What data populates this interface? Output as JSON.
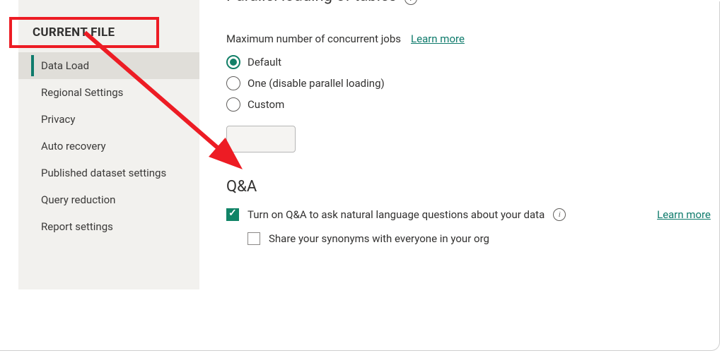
{
  "sidebar": {
    "header": "CURRENT FILE",
    "items": [
      {
        "label": "Data Load"
      },
      {
        "label": "Regional Settings"
      },
      {
        "label": "Privacy"
      },
      {
        "label": "Auto recovery"
      },
      {
        "label": "Published dataset settings"
      },
      {
        "label": "Query reduction"
      },
      {
        "label": "Report settings"
      }
    ]
  },
  "main": {
    "section_title": "Parallel loading of tables",
    "concurrent": {
      "label": "Maximum number of concurrent jobs",
      "learn_more": "Learn more",
      "options": {
        "default": "Default",
        "one": "One (disable parallel loading)",
        "custom": "Custom"
      }
    },
    "qa": {
      "title": "Q&A",
      "check1": "Turn on Q&A to ask natural language questions about your data",
      "learn_more": "Learn more",
      "check2": "Share your synonyms with everyone in your org"
    }
  }
}
